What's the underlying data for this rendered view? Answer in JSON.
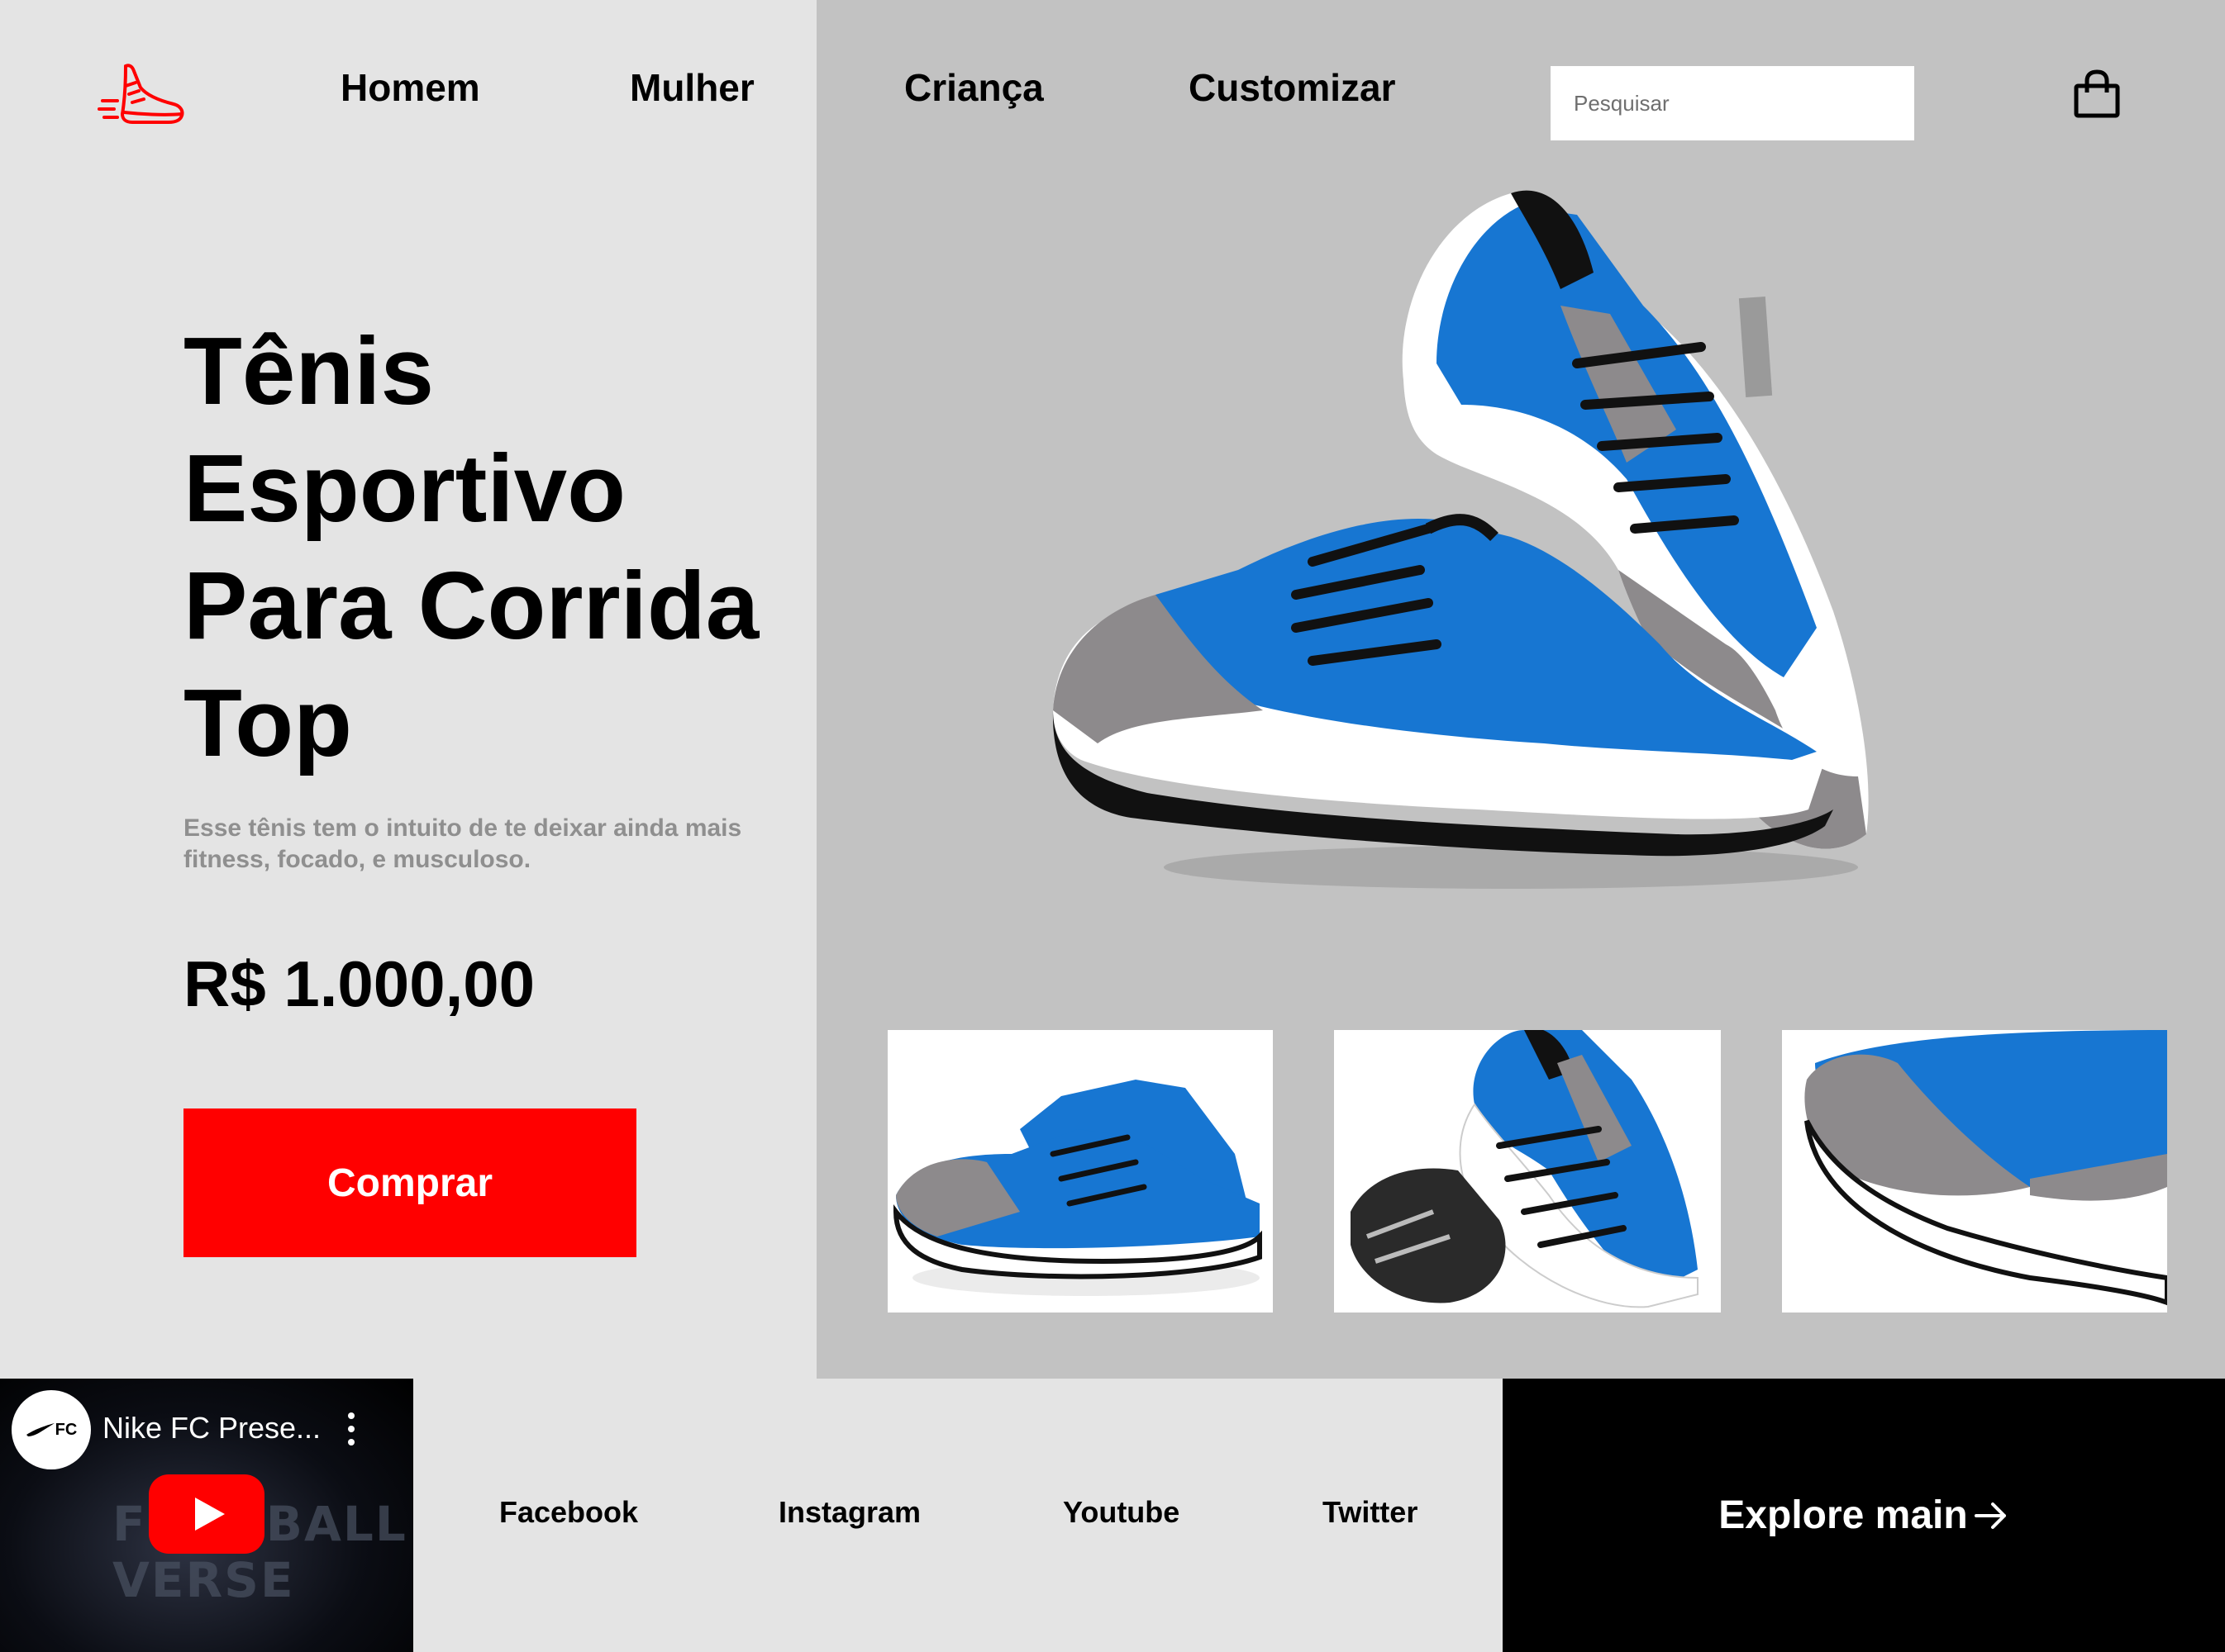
{
  "header": {
    "logo_icon": "running-shoe-icon",
    "nav": [
      {
        "label": "Homem"
      },
      {
        "label": "Mulher"
      },
      {
        "label": "Criança"
      },
      {
        "label": "Customizar"
      }
    ],
    "search": {
      "placeholder": "Pesquisar",
      "value": ""
    },
    "bag_icon": "shopping-bag-icon"
  },
  "hero": {
    "title": "Tênis Esportivo Para Corrida Top",
    "description": "Esse tênis tem o intuito de te deixar ainda mais fitness, focado, e musculoso.",
    "price": "R$ 1.000,00",
    "buy_label": "Comprar"
  },
  "video": {
    "title": "Nike FC Prese...",
    "channel_badge": "FC",
    "background_text": "FOOTBALL VERSE"
  },
  "social": [
    {
      "label": "Facebook"
    },
    {
      "label": "Instagram"
    },
    {
      "label": "Youtube"
    },
    {
      "label": "Twitter"
    }
  ],
  "explore": {
    "label": "Explore main",
    "icon": "arrow-right-icon"
  },
  "colors": {
    "accent": "#ff0000",
    "panel_light": "#e4e4e4",
    "panel_gray": "#c2c2c2",
    "shoe_blue": "#1776d2",
    "muted_text": "#8f8f8f",
    "footer_dark": "#000000"
  }
}
